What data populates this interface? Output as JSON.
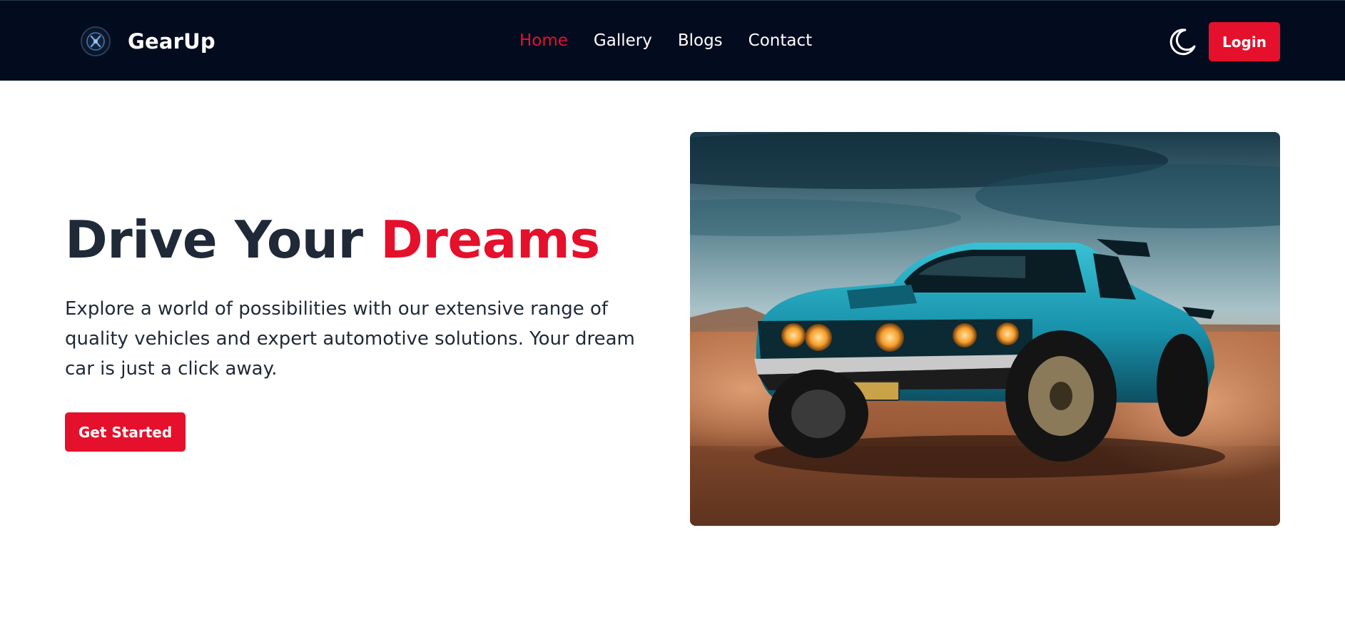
{
  "brand": {
    "name": "GearUp",
    "logo_icon": "gear-logo-icon"
  },
  "nav": {
    "links": [
      {
        "label": "Home",
        "active": true
      },
      {
        "label": "Gallery",
        "active": false
      },
      {
        "label": "Blogs",
        "active": false
      },
      {
        "label": "Contact",
        "active": false
      }
    ],
    "theme_icon": "moon-icon",
    "login_label": "Login"
  },
  "hero": {
    "title_main": "Drive Your",
    "title_accent": "Dreams",
    "description": "Explore a world of possibilities with our extensive range of quality vehicles and expert automotive solutions. Your dream car is just a click away.",
    "cta_label": "Get Started",
    "image_icon": "teal-muscle-car-desert-photo"
  },
  "colors": {
    "navbar_bg": "#030b1f",
    "accent": "#e5102b",
    "text_dark": "#1f2937",
    "white": "#ffffff"
  }
}
